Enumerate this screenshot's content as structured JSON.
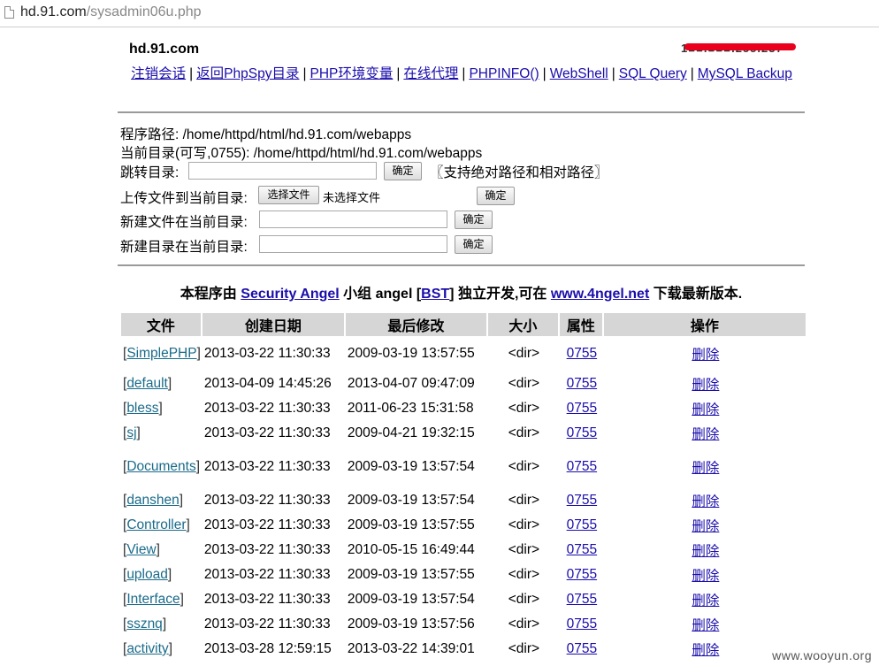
{
  "browser": {
    "url_host": "hd.91.com",
    "url_path": "/sysadmin06u.php"
  },
  "header": {
    "site": "hd.91.com",
    "ip_partial": "1■■.■■■.255.237"
  },
  "nav": [
    "注销会话",
    "返回PhpSpy目录",
    "PHP环境变量",
    "在线代理",
    "PHPINFO()",
    "WebShell",
    "SQL Query",
    "MySQL Backup"
  ],
  "paths": {
    "program_label": "程序路径:",
    "program_path": "/home/httpd/html/hd.91.com/webapps",
    "current_label": "当前目录(可写,0755):",
    "current_path": "/home/httpd/html/hd.91.com/webapps"
  },
  "forms": {
    "jump_label": "跳转目录:",
    "jump_hint": "〖支持绝对路径和相对路径〗",
    "upload_label": "上传文件到当前目录:",
    "choose_file": "选择文件",
    "no_file": "未选择文件",
    "newfile_label": "新建文件在当前目录:",
    "newdir_label": "新建目录在当前目录:",
    "confirm": "确定"
  },
  "credit": {
    "pre": "本程序由",
    "team": "Security Angel",
    "mid1": "小组 angel [",
    "bst": "BST",
    "mid2": "] 独立开发,可在",
    "site": "www.4ngel.net",
    "post": "下载最新版本."
  },
  "table": {
    "headers": [
      "文件",
      "创建日期",
      "最后修改",
      "大小",
      "属性",
      "操作"
    ],
    "rows": [
      {
        "name": "SimplePHP",
        "created": "2013-03-22 11:30:33",
        "modified": "2009-03-19 13:57:55",
        "size": "<dir>",
        "perm": "0755",
        "action": "删除"
      },
      {
        "name": "default",
        "created": "2013-04-09 14:45:26",
        "modified": "2013-04-07 09:47:09",
        "size": "<dir>",
        "perm": "0755",
        "action": "删除"
      },
      {
        "name": "bless",
        "created": "2013-03-22 11:30:33",
        "modified": "2011-06-23 15:31:58",
        "size": "<dir>",
        "perm": "0755",
        "action": "删除"
      },
      {
        "name": "sj",
        "created": "2013-03-22 11:30:33",
        "modified": "2009-04-21 19:32:15",
        "size": "<dir>",
        "perm": "0755",
        "action": "删除"
      },
      {
        "name": "Documents",
        "created": "2013-03-22 11:30:33",
        "modified": "2009-03-19 13:57:54",
        "size": "<dir>",
        "perm": "0755",
        "action": "删除"
      },
      {
        "name": "danshen",
        "created": "2013-03-22 11:30:33",
        "modified": "2009-03-19 13:57:54",
        "size": "<dir>",
        "perm": "0755",
        "action": "删除"
      },
      {
        "name": "Controller",
        "created": "2013-03-22 11:30:33",
        "modified": "2009-03-19 13:57:55",
        "size": "<dir>",
        "perm": "0755",
        "action": "删除"
      },
      {
        "name": "View",
        "created": "2013-03-22 11:30:33",
        "modified": "2010-05-15 16:49:44",
        "size": "<dir>",
        "perm": "0755",
        "action": "删除"
      },
      {
        "name": "upload",
        "created": "2013-03-22 11:30:33",
        "modified": "2009-03-19 13:57:55",
        "size": "<dir>",
        "perm": "0755",
        "action": "删除"
      },
      {
        "name": "Interface",
        "created": "2013-03-22 11:30:33",
        "modified": "2009-03-19 13:57:54",
        "size": "<dir>",
        "perm": "0755",
        "action": "删除"
      },
      {
        "name": "ssznq",
        "created": "2013-03-22 11:30:33",
        "modified": "2009-03-19 13:57:56",
        "size": "<dir>",
        "perm": "0755",
        "action": "删除"
      },
      {
        "name": "activity",
        "created": "2013-03-28 12:59:15",
        "modified": "2013-03-22 14:39:01",
        "size": "<dir>",
        "perm": "0755",
        "action": "删除"
      }
    ]
  },
  "watermark": "www.wooyun.org",
  "colors": {
    "link": "#1a0dab",
    "header_bg": "#d6d6d6",
    "rule": "#9a9a9a",
    "redaction": "#e8001c"
  }
}
